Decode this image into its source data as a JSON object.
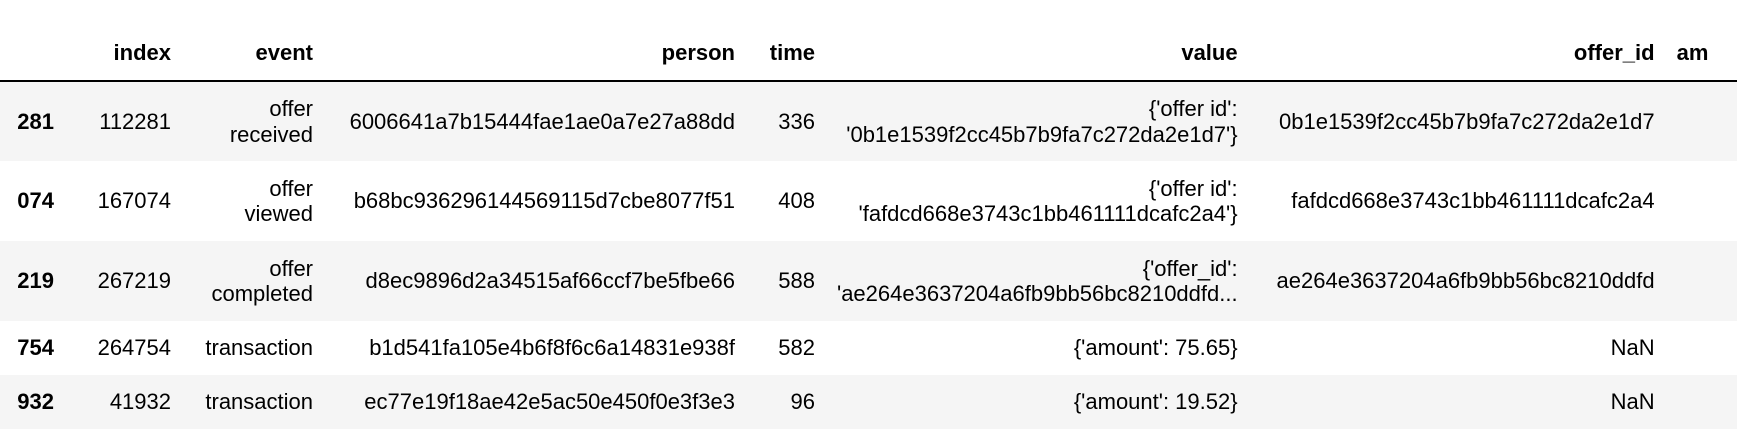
{
  "table": {
    "columns": [
      "",
      "index",
      "event",
      "person",
      "time",
      "value",
      "offer_id",
      "am"
    ],
    "rows": [
      {
        "row_index": "281",
        "index": "112281",
        "event": [
          "offer",
          "received"
        ],
        "person": "6006641a7b15444fae1ae0a7e27a88dd",
        "time": "336",
        "value": [
          "{'offer id':",
          "'0b1e1539f2cc45b7b9fa7c272da2e1d7'}"
        ],
        "offer_id": "0b1e1539f2cc45b7b9fa7c272da2e1d7"
      },
      {
        "row_index": "074",
        "index": "167074",
        "event": [
          "offer",
          "viewed"
        ],
        "person": "b68bc936296144569115d7cbe8077f51",
        "time": "408",
        "value": [
          "{'offer id':",
          "'fafdcd668e3743c1bb461111dcafc2a4'}"
        ],
        "offer_id": "fafdcd668e3743c1bb461111dcafc2a4"
      },
      {
        "row_index": "219",
        "index": "267219",
        "event": [
          "offer",
          "completed"
        ],
        "person": "d8ec9896d2a34515af66ccf7be5fbe66",
        "time": "588",
        "value": [
          "{'offer_id':",
          "'ae264e3637204a6fb9bb56bc8210ddfd..."
        ],
        "offer_id": "ae264e3637204a6fb9bb56bc8210ddfd"
      },
      {
        "row_index": "754",
        "index": "264754",
        "event": [
          "transaction"
        ],
        "person": "b1d541fa105e4b6f8f6c6a14831e938f",
        "time": "582",
        "value": [
          "{'amount': 75.65}"
        ],
        "offer_id": "NaN"
      },
      {
        "row_index": "932",
        "index": "41932",
        "event": [
          "transaction"
        ],
        "person": "ec77e19f18ae42e5ac50e450f0e3f3e3",
        "time": "96",
        "value": [
          "{'amount': 19.52}"
        ],
        "offer_id": "NaN"
      }
    ]
  }
}
